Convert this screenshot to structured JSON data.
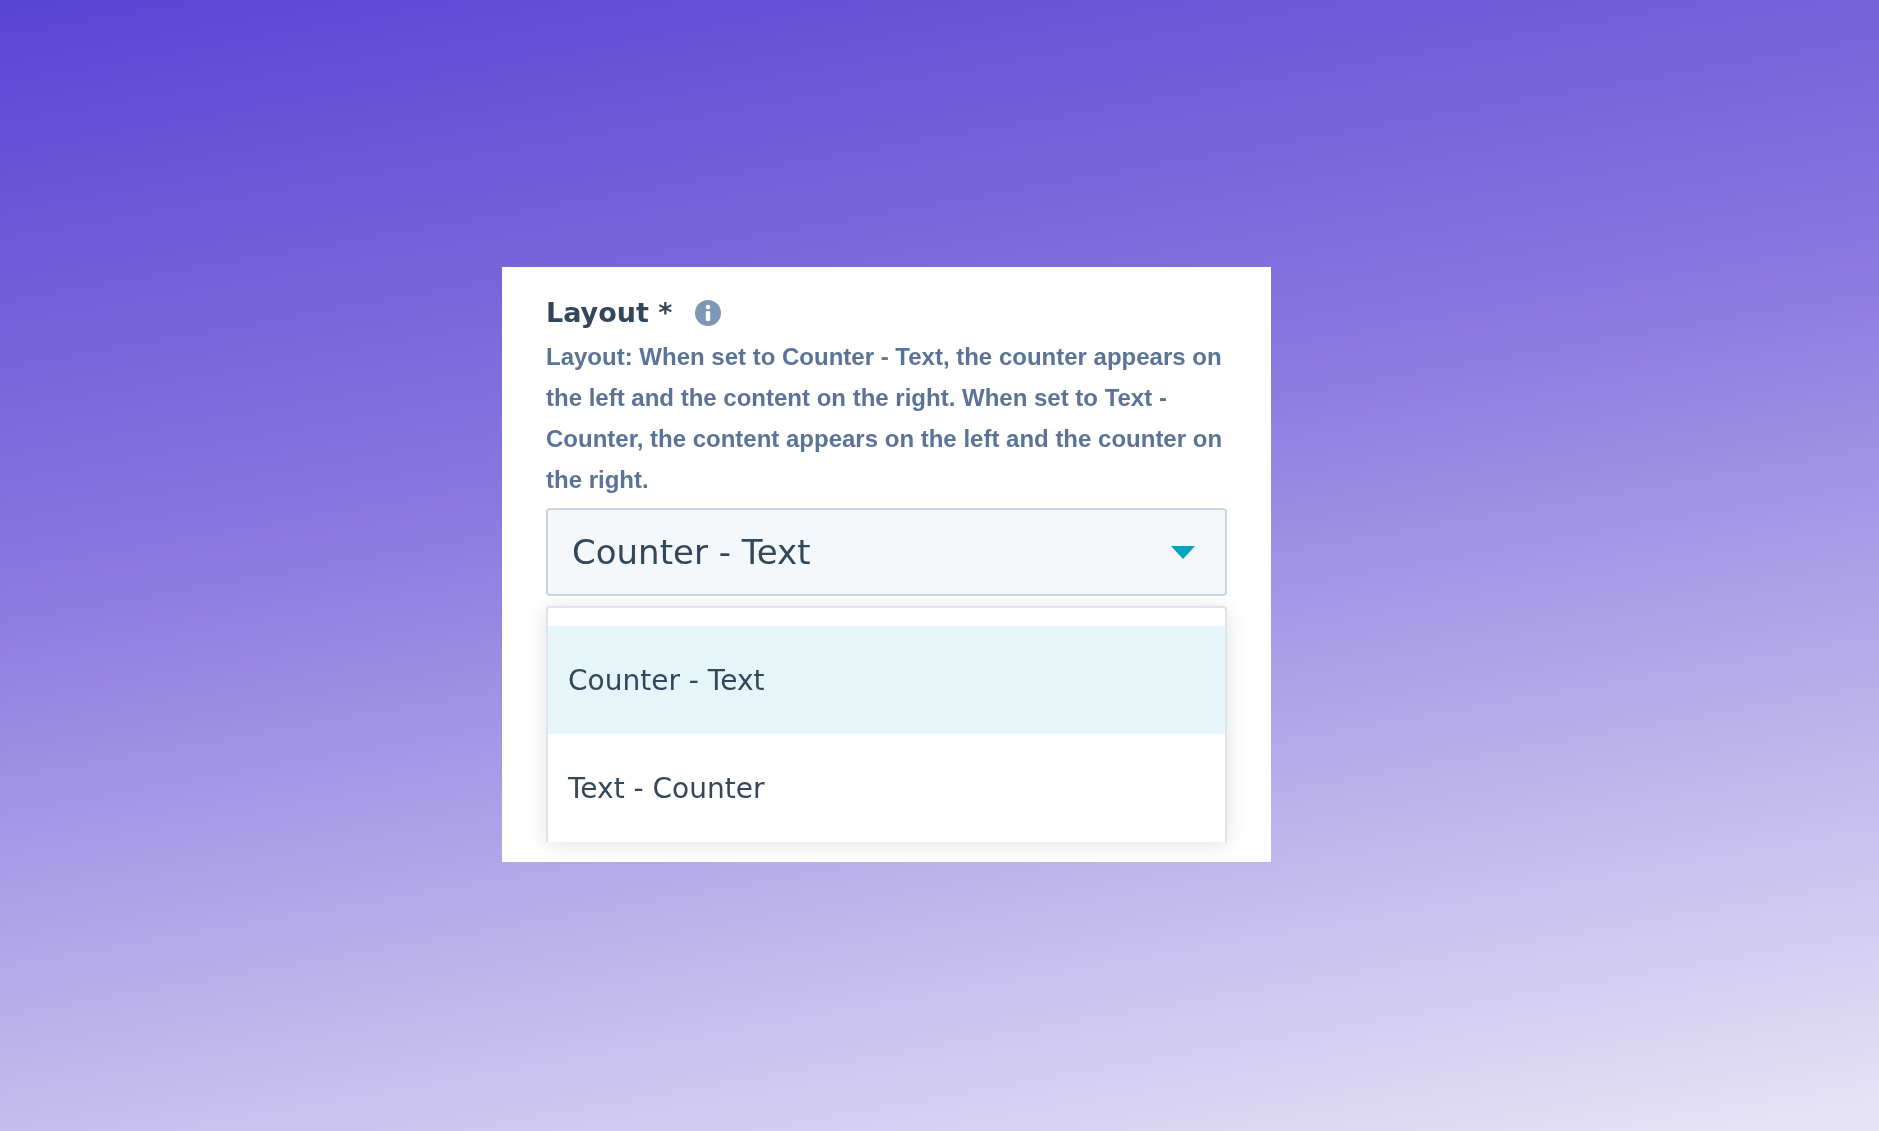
{
  "field": {
    "label": "Layout *",
    "help": "Layout: When set to Counter - Text, the counter appears on the left and the content on the right. When set to Text - Counter, the content appears on the left and the counter on the right.",
    "select": {
      "value": "Counter - Text",
      "expanded": true
    },
    "options": [
      {
        "label": "Counter - Text",
        "selected": true
      },
      {
        "label": "Text - Counter",
        "selected": false
      }
    ]
  }
}
